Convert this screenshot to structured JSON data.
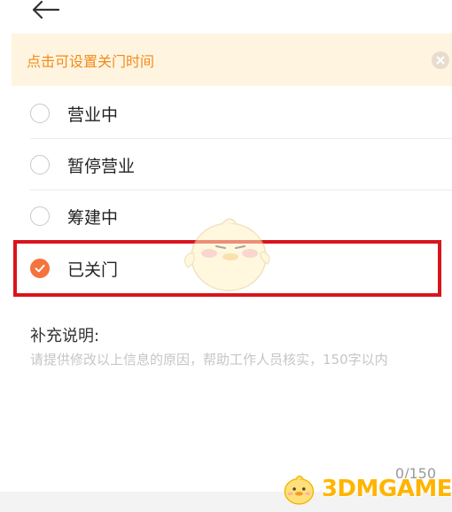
{
  "notice": {
    "text": "点击可设置关门时间"
  },
  "status_options": [
    {
      "label": "营业中",
      "selected": false
    },
    {
      "label": "暂停营业",
      "selected": false
    },
    {
      "label": "筹建中",
      "selected": false
    },
    {
      "label": "已关门",
      "selected": true
    }
  ],
  "remarks": {
    "title": "补充说明:",
    "placeholder": "请提供修改以上信息的原因，帮助工作人员核实，150字以内",
    "counter": "0/150"
  },
  "watermark": {
    "text": "3DMGAME"
  },
  "colors": {
    "accent": "#f5733c",
    "notice_bg": "#fff4e0",
    "notice_text": "#f08c1a",
    "highlight_border": "#d9141c"
  }
}
